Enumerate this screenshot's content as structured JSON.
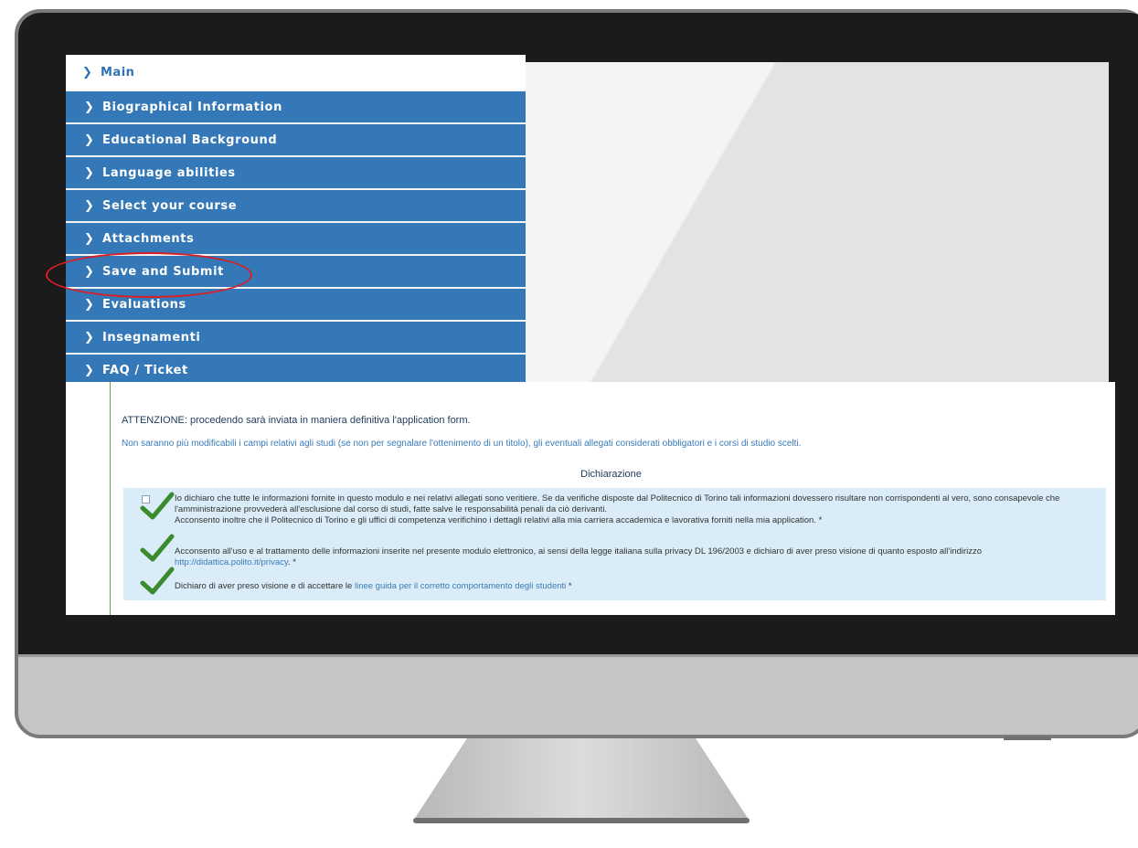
{
  "nav": {
    "main": "Main",
    "items": [
      {
        "label": "Biographical Information"
      },
      {
        "label": "Educational Background"
      },
      {
        "label": "Language abilities"
      },
      {
        "label": "Select your course"
      },
      {
        "label": "Attachments"
      },
      {
        "label": "Save and Submit"
      },
      {
        "label": "Evaluations"
      },
      {
        "label": "Insegnamenti"
      },
      {
        "label": "FAQ / Ticket"
      }
    ]
  },
  "content": {
    "attention": "ATTENZIONE: procedendo sarà inviata in maniera definitiva l'application form.",
    "note": "Non saranno più modificabili i campi relativi agli studi (se non per segnalare l'ottenimento di un titolo), gli eventuali allegati considerati obbligatori e i corsi di studio scelti.",
    "declaration_title": "Dichiarazione",
    "declarations": [
      {
        "line1": "Io dichiaro che tutte le informazioni fornite in questo modulo e nei relativi allegati sono veritiere. Se da verifiche disposte dal Politecnico di Torino tali informazioni dovessero risultare non corrispondenti al vero, sono consapevole che",
        "line2": "l'amministrazione provvederà all'esclusione dal corso di studi, fatte salve le responsabilità penali da ciò derivanti.",
        "line3": "Acconsento inoltre che il Politecnico di Torino e gli uffici di competenza verifichino i dettagli relativi alla mia carriera accademica e lavorativa forniti nella mia application. *"
      },
      {
        "line1": "Acconsento all'uso e al trattamento delle informazioni inserite nel presente modulo elettronico, ai sensi della legge italiana sulla privacy DL 196/2003 e dichiaro di aver preso visione di quanto esposto all'indirizzo",
        "link": "http://didattica.polito.it/privacy",
        "suffix": ". *"
      },
      {
        "prefix": "Dichiaro di aver preso visione e di accettare le ",
        "link": "linee guida per il corretto comportamento degli studenti",
        "suffix": " *"
      }
    ]
  },
  "colors": {
    "nav_blue": "#3478b7",
    "declaration_bg": "#d9ecf7",
    "tick_green": "#3a8a2e",
    "highlight_red": "#d81f26"
  }
}
